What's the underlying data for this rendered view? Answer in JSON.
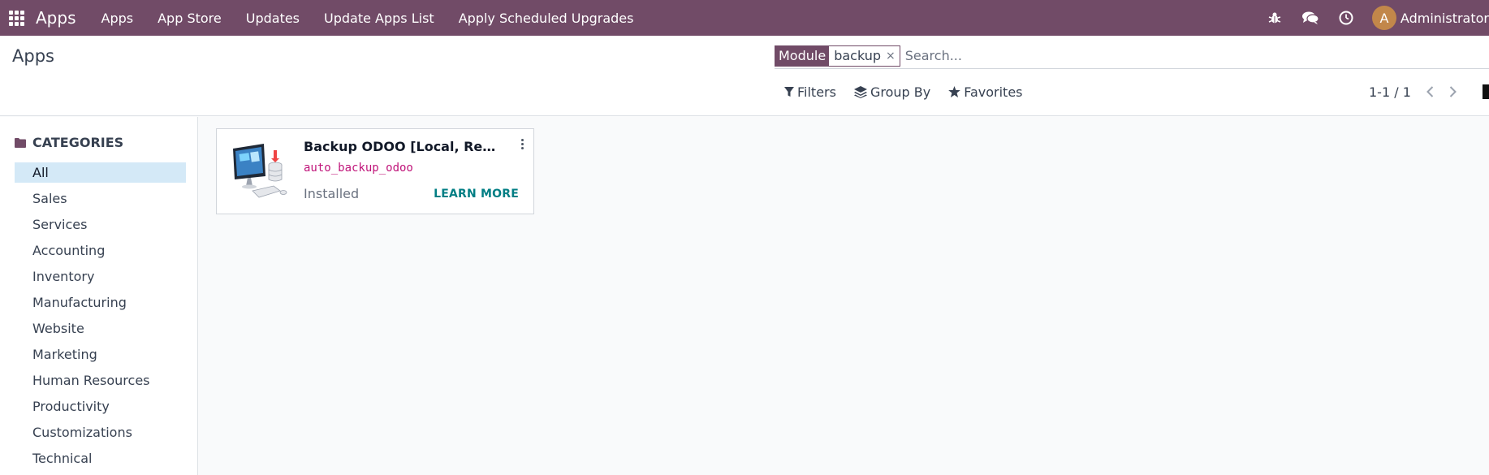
{
  "navbar": {
    "brand": "Apps",
    "menu": [
      "Apps",
      "App Store",
      "Updates",
      "Update Apps List",
      "Apply Scheduled Upgrades"
    ],
    "user": {
      "initial": "A",
      "name": "Administrator"
    },
    "icons": [
      "bug-icon",
      "chat-icon",
      "clock-icon"
    ]
  },
  "control_panel": {
    "title": "Apps",
    "search": {
      "facet_label": "Module",
      "facet_value": "backup",
      "facet_remove": "×",
      "placeholder": "Search..."
    },
    "filters": {
      "filters": "Filters",
      "group_by": "Group By",
      "favorites": "Favorites"
    },
    "pager": "1-1 / 1"
  },
  "sidebar": {
    "header": "CATEGORIES",
    "items": [
      "All",
      "Sales",
      "Services",
      "Accounting",
      "Inventory",
      "Manufacturing",
      "Website",
      "Marketing",
      "Human Resources",
      "Productivity",
      "Customizations",
      "Technical"
    ],
    "active": "All"
  },
  "card": {
    "title": "Backup ODOO [Local, Remote, FTP, SFTP, Dropbox, Google Drive]",
    "technical_name": "auto_backup_odoo",
    "status": "Installed",
    "action": "LEARN MORE"
  },
  "colors": {
    "brand": "#714b67",
    "active_category": "#d4e9f7",
    "tech_name": "#c0157a",
    "learn_more": "#017e84"
  }
}
